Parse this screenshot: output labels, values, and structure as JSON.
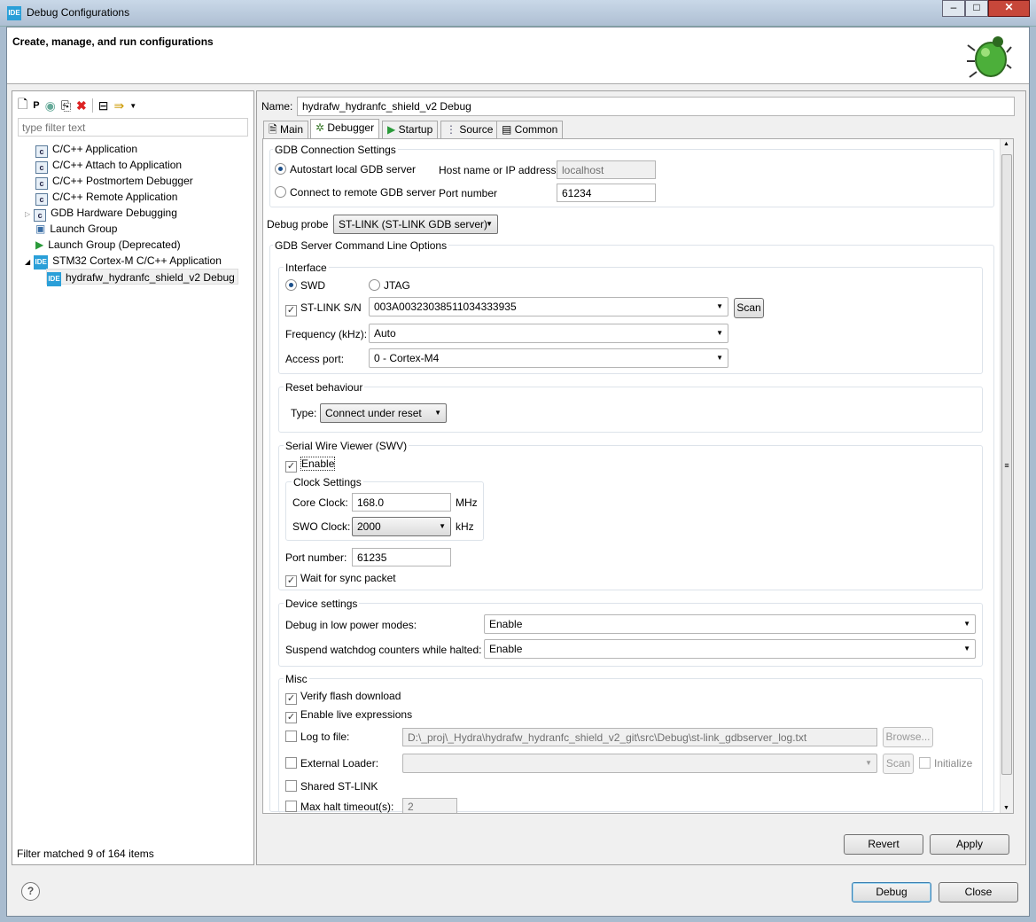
{
  "window": {
    "title": "Debug Configurations",
    "header": "Create, manage, and run configurations"
  },
  "toolbar": {
    "icons": [
      "new-configuration-icon",
      "new-prototype-icon",
      "export-icon",
      "duplicate-icon",
      "delete-icon",
      "collapse-all-icon",
      "filter-icon",
      "dropdown-icon"
    ]
  },
  "filter": {
    "placeholder": "type filter text",
    "status": "Filter matched 9 of 164 items"
  },
  "tree": [
    {
      "label": "C/C++ Application",
      "icon": "c-icon"
    },
    {
      "label": "C/C++ Attach to Application",
      "icon": "c-icon"
    },
    {
      "label": "C/C++ Postmortem Debugger",
      "icon": "c-icon"
    },
    {
      "label": "C/C++ Remote Application",
      "icon": "c-icon"
    },
    {
      "label": "GDB Hardware Debugging",
      "icon": "c-icon"
    },
    {
      "label": "Launch Group",
      "icon": "launch-group-icon"
    },
    {
      "label": "Launch Group (Deprecated)",
      "icon": "play-icon"
    },
    {
      "label": "STM32 Cortex-M C/C++ Application",
      "icon": "ide-icon"
    },
    {
      "label": "hydrafw_hydranfc_shield_v2 Debug",
      "icon": "ide-icon"
    }
  ],
  "name": {
    "label": "Name:",
    "value": "hydrafw_hydranfc_shield_v2 Debug"
  },
  "tabs": [
    "Main",
    "Debugger",
    "Startup",
    "Source",
    "Common"
  ],
  "gdb": {
    "title": "GDB Connection Settings",
    "autostart": "Autostart local GDB server",
    "remote": "Connect to remote GDB server",
    "host_label": "Host name or IP address",
    "host_value": "localhost",
    "port_label": "Port number",
    "port_value": "61234"
  },
  "probe": {
    "label": "Debug probe",
    "value": "ST-LINK (ST-LINK GDB server)"
  },
  "server_options": "GDB Server Command Line Options",
  "interface": {
    "title": "Interface",
    "swd": "SWD",
    "jtag": "JTAG",
    "sn_label": "ST-LINK S/N",
    "sn_value": "003A00323038511034333935",
    "scan": "Scan",
    "freq_label": "Frequency (kHz):",
    "freq_value": "Auto",
    "ap_label": "Access port:",
    "ap_value": "0 - Cortex-M4"
  },
  "reset": {
    "title": "Reset behaviour",
    "type_label": "Type:",
    "type_value": "Connect under reset"
  },
  "swv": {
    "title": "Serial Wire Viewer (SWV)",
    "enable": "Enable",
    "clock_title": "Clock Settings",
    "core_label": "Core Clock:",
    "core_value": "168.0",
    "core_unit": "MHz",
    "swo_label": "SWO Clock:",
    "swo_value": "2000",
    "swo_unit": "kHz",
    "port_label": "Port number:",
    "port_value": "61235",
    "wait": "Wait for sync packet"
  },
  "device": {
    "title": "Device settings",
    "low_power_label": "Debug in low power modes:",
    "low_power_value": "Enable",
    "watchdog_label": "Suspend watchdog counters while halted:",
    "watchdog_value": "Enable"
  },
  "misc": {
    "title": "Misc",
    "verify": "Verify flash download",
    "live": "Enable live expressions",
    "log_label": "Log to file:",
    "log_value": "D:\\_proj\\_Hydra\\hydrafw_hydranfc_shield_v2_git\\src\\Debug\\st-link_gdbserver_log.txt",
    "browse": "Browse...",
    "loader_label": "External Loader:",
    "loader_scan": "Scan",
    "initialize": "Initialize",
    "shared": "Shared ST-LINK",
    "halt_label": "Max halt timeout(s):",
    "halt_value": "2"
  },
  "buttons": {
    "revert": "Revert",
    "apply": "Apply",
    "debug": "Debug",
    "close": "Close"
  }
}
